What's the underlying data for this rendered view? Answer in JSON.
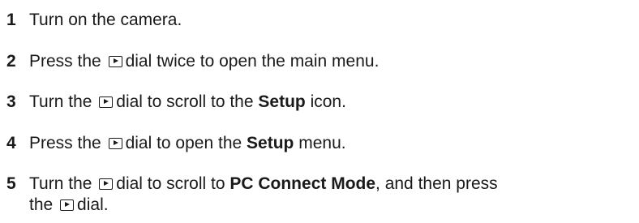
{
  "steps": [
    {
      "number": "1",
      "text": "Turn on the camera."
    },
    {
      "number": "2",
      "pre": "Press the",
      "icon": "playback-dial-icon",
      "post": "dial twice to open the main menu."
    },
    {
      "number": "3",
      "pre": "Turn the",
      "icon": "playback-dial-icon",
      "mid": "dial to scroll to the",
      "bold": "Setup",
      "post": "icon."
    },
    {
      "number": "4",
      "pre": "Press the",
      "icon": "playback-dial-icon",
      "mid": "dial to open the",
      "bold": "Setup",
      "post": "menu."
    },
    {
      "number": "5",
      "pre": "Turn the",
      "icon": "playback-dial-icon",
      "mid": "dial to scroll to",
      "bold": "PC Connect Mode",
      "post": ", and then press",
      "line2_pre": "the",
      "line2_icon": "playback-dial-icon",
      "line2_post": "dial."
    }
  ]
}
